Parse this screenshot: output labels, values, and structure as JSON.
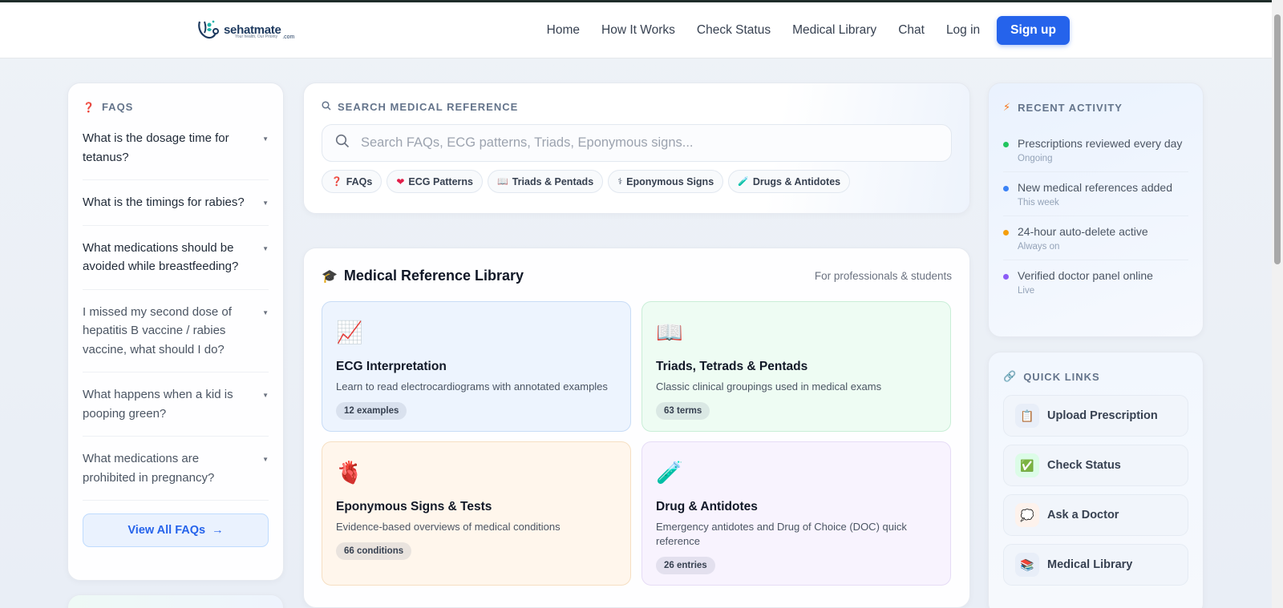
{
  "brand": {
    "name": "sehatmate",
    "domain": ".com",
    "tagline": "Your health, Our Priority"
  },
  "nav": {
    "home": "Home",
    "how": "How It Works",
    "status": "Check Status",
    "library": "Medical Library",
    "chat": "Chat",
    "login": "Log in",
    "signup": "Sign up"
  },
  "faq": {
    "title": "FAQS",
    "items": [
      {
        "q": "What is the dosage time for tetanus?"
      },
      {
        "q": "What is the timings for rabies?"
      },
      {
        "q": "What medications should be avoided while breastfeeding?"
      },
      {
        "q": "I missed my second dose of hepatitis B vaccine / rabies vaccine, what should I do?"
      },
      {
        "q": "What happens when a kid is pooping green?"
      },
      {
        "q": "What medications are prohibited in pregnancy?"
      }
    ],
    "view_all": "View All FAQs"
  },
  "search": {
    "title": "SEARCH MEDICAL REFERENCE",
    "placeholder": "Search FAQs, ECG patterns, Triads, Eponymous signs...",
    "chips": [
      "FAQs",
      "ECG Patterns",
      "Triads & Pentads",
      "Eponymous Signs",
      "Drugs & Antidotes"
    ]
  },
  "library": {
    "title": "Medical Reference Library",
    "subtitle": "For professionals & students",
    "tiles": [
      {
        "title": "ECG Interpretation",
        "desc": "Learn to read electrocardiograms with annotated examples",
        "badge": "12 examples"
      },
      {
        "title": "Triads, Tetrads & Pentads",
        "desc": "Classic clinical groupings used in medical exams",
        "badge": "63 terms"
      },
      {
        "title": "Eponymous Signs & Tests",
        "desc": "Evidence-based overviews of medical conditions",
        "badge": "66 conditions"
      },
      {
        "title": "Drug & Antidotes",
        "desc": "Emergency antidotes and Drug of Choice (DOC) quick reference",
        "badge": "26 entries"
      }
    ]
  },
  "activity": {
    "title": "RECENT ACTIVITY",
    "items": [
      {
        "text": "Prescriptions reviewed every day",
        "time": "Ongoing",
        "color": "#22c55e"
      },
      {
        "text": "New medical references added",
        "time": "This week",
        "color": "#3b82f6"
      },
      {
        "text": "24-hour auto-delete active",
        "time": "Always on",
        "color": "#f59e0b"
      },
      {
        "text": "Verified doctor panel online",
        "time": "Live",
        "color": "#8b5cf6"
      }
    ]
  },
  "quick_links": {
    "title": "QUICK LINKS",
    "items": [
      {
        "label": "Upload Prescription",
        "icon": "clipboard-icon"
      },
      {
        "label": "Check Status",
        "icon": "checkbox-icon"
      },
      {
        "label": "Ask a Doctor",
        "icon": "speech-bubble-icon"
      },
      {
        "label": "Medical Library",
        "icon": "books-icon"
      }
    ]
  },
  "colors": {
    "accent": "#2563eb"
  }
}
